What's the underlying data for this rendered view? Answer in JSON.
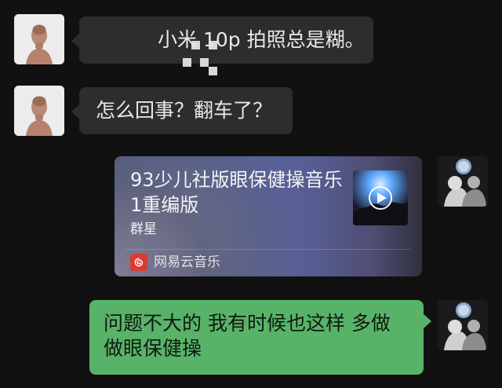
{
  "messages": [
    {
      "side": "left",
      "type": "text-with-sticker",
      "text": "小米 10p 拍照总是糊。"
    },
    {
      "side": "left",
      "type": "text",
      "text": "怎么回事？翻车了？"
    },
    {
      "side": "right",
      "type": "music-card",
      "title": "93少儿社版眼保健操音乐1重编版",
      "artist": "群星",
      "source": "网易云音乐"
    },
    {
      "side": "right",
      "type": "text",
      "text": "问题不大的 我有时候也这样 多做做眼保健操"
    }
  ],
  "colors": {
    "background": "#111111",
    "incoming_bubble": "#2d2d2d",
    "outgoing_bubble": "#58b368",
    "music_card_start": "#3e5d9f",
    "music_card_end": "#302f3f",
    "netease_red": "#d93b33"
  },
  "icons": {
    "left_avatar": "portrait-avatar",
    "right_avatar": "portrait-avatar",
    "sticker": "pixel-sticker",
    "netease": "netease-music-icon",
    "play": "play-icon"
  }
}
